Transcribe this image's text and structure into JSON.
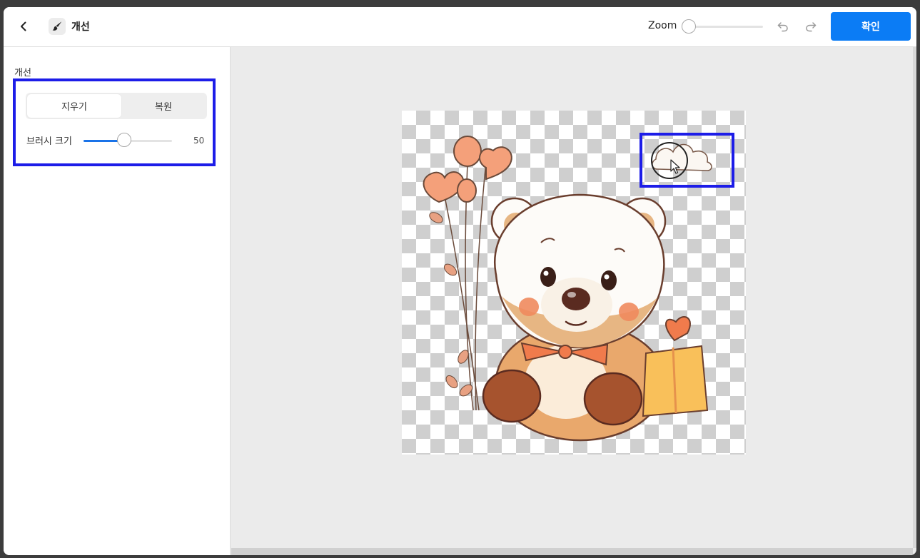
{
  "header": {
    "title": "개선",
    "zoom_label": "Zoom",
    "zoom_level": 0,
    "confirm_label": "확인"
  },
  "sidebar": {
    "heading": "개선",
    "modes": [
      {
        "label": "지우기",
        "active": true
      },
      {
        "label": "복원",
        "active": false
      }
    ],
    "brush_size_label": "브러시 크기",
    "brush_size_value": "50",
    "brush_size_fraction": 0.46
  },
  "icons": {
    "back": "chevron-left-icon",
    "tool": "brush-icon",
    "undo": "undo-icon",
    "redo": "redo-icon",
    "pointer": "mouse-pointer-icon"
  },
  "colors": {
    "accent": "#0b7cf5",
    "highlight_border": "#1d1de8",
    "slider_fill": "#1a73e8"
  }
}
